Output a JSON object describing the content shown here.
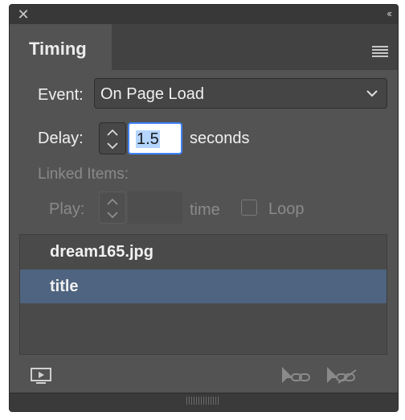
{
  "panel": {
    "tab_title": "Timing"
  },
  "event": {
    "label": "Event:",
    "value": "On Page Load"
  },
  "delay": {
    "label": "Delay:",
    "value": "1.5",
    "unit": "seconds"
  },
  "linked": {
    "heading": "Linked Items:",
    "play_label": "Play:",
    "play_value": "",
    "time_label": "time",
    "loop_label": "Loop",
    "loop_checked": false
  },
  "items": [
    {
      "name": "dream165.jpg",
      "selected": false
    },
    {
      "name": "title",
      "selected": true
    }
  ],
  "icons": {
    "close": "close-icon",
    "collapse": "double-chevron-left-icon",
    "menu": "hamburger-menu-icon",
    "dropdown": "chevron-down-icon",
    "stepper": "up-down-arrows-icon",
    "preview": "preview-monitor-icon",
    "link": "link-items-icon",
    "unlink": "unlink-items-icon"
  },
  "colors": {
    "panel_bg": "#535353",
    "selection_row": "#4f6480",
    "focus_ring": "#3f83ff",
    "text_highlight": "#b4d5ff"
  }
}
